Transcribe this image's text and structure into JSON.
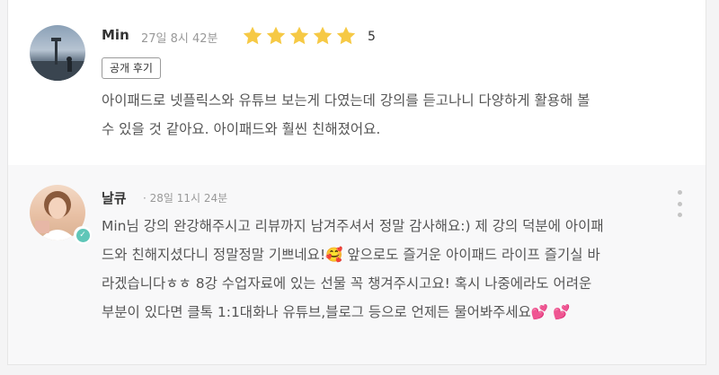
{
  "review": {
    "author": "Min",
    "date": "27일 8시 42분",
    "rating": "5",
    "rating_value": 5,
    "tag": "공개 후기",
    "text": "아이패드로 넷플릭스와 유튜브 보는게 다였는데 강의를 듣고나니 다양하게 활용해 볼\n수 있을 것 같아요. 아이패드와 훨씬 친해졌어요."
  },
  "reply": {
    "author": "날큐",
    "date": "· 28일 11시 24분",
    "text": "Min님 강의 완강해주시고 리뷰까지 남겨주셔서 정말 감사해요:) 제 강의 덕분에 아이패\n드와 친해지셨다니 정말정말 기쁘네요!🥰  앞으로도 즐거운 아이패드 라이프 즐기실 바\n라겠습니다ㅎㅎ 8강 수업자료에 있는 선물 꼭 챙겨주시고요! 혹시 나중에라도 어려운\n부분이 있다면 클톡 1:1대화나 유튜브,블로그 등으로 언제든 물어봐주세요💕 💕"
  },
  "icons": {
    "star": "star-icon",
    "more": "more-vertical-icon",
    "badge": "verified-badge-icon"
  },
  "colors": {
    "star": "#f6c945",
    "badge": "#5fc6b8",
    "reply_bg": "#f8f8f9"
  }
}
